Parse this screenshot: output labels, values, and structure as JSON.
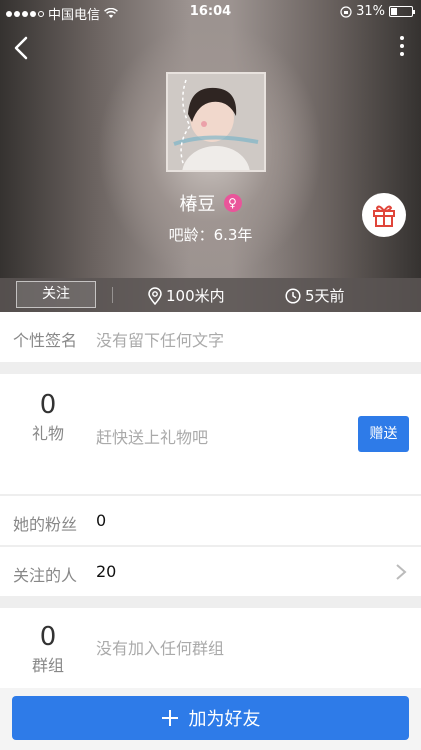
{
  "status_bar": {
    "carrier": "中国电信",
    "time": "16:04",
    "battery": "31%",
    "battery_level": 0.31
  },
  "profile": {
    "name": "椿豆",
    "gender_symbol": "♀",
    "age_text": "吧龄：6.3年"
  },
  "info_bar": {
    "follow_label": "关注",
    "distance": "100米内",
    "last_seen": "5天前"
  },
  "signature": {
    "label": "个性签名",
    "value": "没有留下任何文字"
  },
  "gifts": {
    "count": "0",
    "label": "礼物",
    "hint": "赶快送上礼物吧",
    "send_label": "赠送"
  },
  "fans": {
    "label": "她的粉丝",
    "value": "0"
  },
  "following": {
    "label": "关注的人",
    "value": "20"
  },
  "groups": {
    "count": "0",
    "label": "群组",
    "hint": "没有加入任何群组"
  },
  "actions": {
    "add_friend_label": "加为好友"
  },
  "colors": {
    "accent": "#2e7be8",
    "female": "#e9559a",
    "gift_red": "#e0453a"
  },
  "icons": [
    "back-icon",
    "more-icon",
    "female-icon",
    "gift-icon",
    "location-pin-icon",
    "clock-icon",
    "chevron-right-icon",
    "plus-icon",
    "wifi-icon",
    "lock-rotation-icon",
    "battery-icon"
  ]
}
